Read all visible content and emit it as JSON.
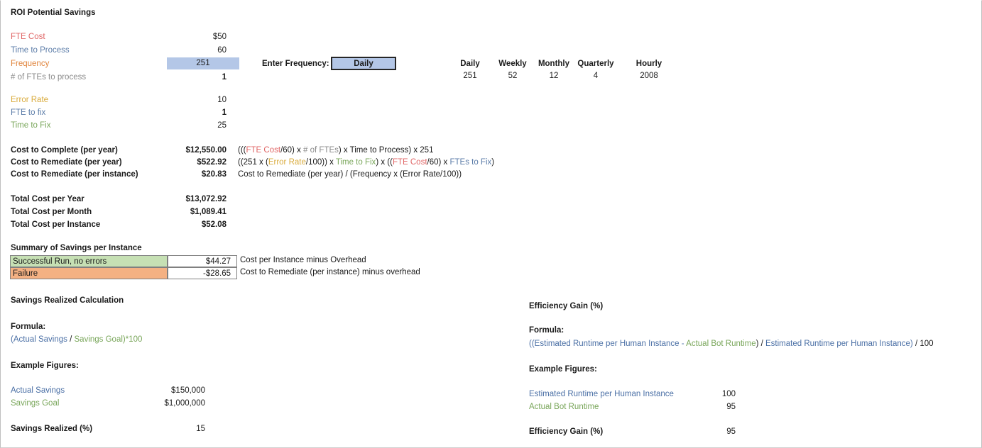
{
  "title": "ROI Potential Savings",
  "inputs": [
    {
      "label": "FTE Cost",
      "value": "$50",
      "color": "c-red"
    },
    {
      "label": "Time to Process",
      "value": "60",
      "color": "c-blue"
    },
    {
      "label": "Frequency",
      "value": "251",
      "color": "c-orange"
    },
    {
      "label": "# of FTEs to process",
      "value": "1",
      "color": "c-gray"
    }
  ],
  "error_inputs": [
    {
      "label": "Error Rate",
      "value": "10",
      "color": "c-gold"
    },
    {
      "label": "FTE to fix",
      "value": "1",
      "color": "c-blue"
    },
    {
      "label": "Time to Fix",
      "value": "25",
      "color": "c-green"
    }
  ],
  "frequency_selector": {
    "prompt": "Enter Frequency:",
    "selected": "Daily"
  },
  "frequency_table": {
    "headers": [
      "Daily",
      "Weekly",
      "Monthly",
      "Quarterly",
      "Hourly"
    ],
    "values": [
      "251",
      "52",
      "12",
      "4",
      "2008"
    ]
  },
  "costs": [
    {
      "label": "Cost to Complete (per year)",
      "value": "$12,550.00",
      "formula": [
        {
          "t": "(((",
          "c": "c-dark"
        },
        {
          "t": "FTE Cost",
          "c": "c-red"
        },
        {
          "t": "/60) x ",
          "c": "c-dark"
        },
        {
          "t": "# of FTEs",
          "c": "c-gray"
        },
        {
          "t": ") x ",
          "c": "c-dark"
        },
        {
          "t": "Time to Process",
          "c": "c-dark"
        },
        {
          "t": ") x 251",
          "c": "c-dark"
        }
      ]
    },
    {
      "label": "Cost to Remediate (per year)",
      "value": "$522.92",
      "formula": [
        {
          "t": "((251 x (",
          "c": "c-dark"
        },
        {
          "t": "Error Rate",
          "c": "c-gold"
        },
        {
          "t": "/100)) x ",
          "c": "c-dark"
        },
        {
          "t": "Time to Fix",
          "c": "c-green"
        },
        {
          "t": ") x ((",
          "c": "c-dark"
        },
        {
          "t": "FTE Cost",
          "c": "c-red"
        },
        {
          "t": "/60) x ",
          "c": "c-dark"
        },
        {
          "t": "FTEs to Fix",
          "c": "c-blue"
        },
        {
          "t": ")",
          "c": "c-dark"
        }
      ]
    },
    {
      "label": "Cost to Remediate (per instance)",
      "value": "$20.83",
      "formula": [
        {
          "t": "Cost to Remediate (per year) / (Frequency x (Error Rate/100))",
          "c": "c-dark"
        }
      ]
    }
  ],
  "totals": [
    {
      "label": "Total Cost per Year",
      "value": "$13,072.92"
    },
    {
      "label": "Total Cost per Month",
      "value": "$1,089.41"
    },
    {
      "label": "Total Cost per Instance",
      "value": "$52.08"
    }
  ],
  "summary": {
    "heading": "Summary of Savings per Instance",
    "rows": [
      {
        "label": "Successful Run, no errors",
        "value": "$44.27",
        "note": "Cost per Instance minus Overhead",
        "fill": "sum-green"
      },
      {
        "label": "Failure",
        "value": "-$28.65",
        "note": "Cost to Remediate (per instance) minus overhead",
        "fill": "sum-orange"
      }
    ]
  },
  "savings_section": {
    "heading": "Savings Realized Calculation",
    "formula_label": "Formula:",
    "formula": [
      {
        "t": "(Actual Savings",
        "c": "c-bluelink"
      },
      {
        "t": " / ",
        "c": "c-dark"
      },
      {
        "t": "Savings Goal)*100",
        "c": "c-green"
      }
    ],
    "examples_label": "Example Figures:",
    "examples": [
      {
        "label": "Actual Savings",
        "value": "$150,000",
        "color": "c-bluelink"
      },
      {
        "label": "Savings Goal",
        "value": "$1,000,000",
        "color": "c-green"
      }
    ],
    "result_label": "Savings Realized (%)",
    "result_value": "15"
  },
  "efficiency_section": {
    "heading": "Efficiency Gain (%)",
    "formula_label": "Formula:",
    "formula": [
      {
        "t": "((Estimated Runtime per Human Instance - ",
        "c": "c-bluelink"
      },
      {
        "t": "Actual Bot Runtime",
        "c": "c-green"
      },
      {
        "t": ") / ",
        "c": "c-dark"
      },
      {
        "t": "Estimated Runtime per Human Instance",
        "c": "c-bluelink"
      },
      {
        "t": ")",
        "c": "c-bluelink"
      },
      {
        "t": " / 100",
        "c": "c-dark"
      }
    ],
    "examples_label": "Example Figures:",
    "examples": [
      {
        "label": "Estimated Runtime per Human Instance",
        "value": "100",
        "color": "c-bluelink"
      },
      {
        "label": "Actual Bot Runtime",
        "value": "95",
        "color": "c-green"
      }
    ],
    "result_label": "Efficiency Gain (%)",
    "result_value": "95"
  },
  "colors": {
    "highlight_fill": "#b4c7e7",
    "success_fill": "#c6e0b4",
    "failure_fill": "#f4b183",
    "red": "#e06666",
    "blue": "#5b7ca8",
    "orange": "#e0843c",
    "gold": "#d9ab3c",
    "green": "#79a65a",
    "gray": "#8c8c8c"
  }
}
